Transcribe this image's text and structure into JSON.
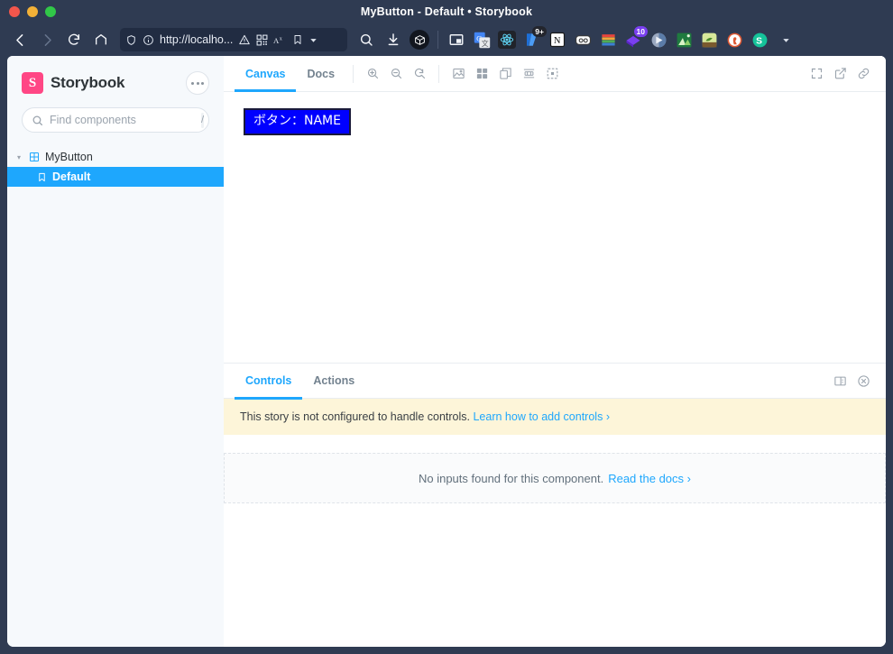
{
  "window": {
    "title": "MyButton - Default • Storybook"
  },
  "browser": {
    "back_icon": "back-arrow-icon",
    "forward_icon": "forward-arrow-icon",
    "reload_icon": "reload-icon",
    "home_icon": "home-icon",
    "url": "http://localho...",
    "url_icons": [
      "shield-icon",
      "info-icon",
      "warning-icon",
      "qr-code-icon",
      "reader-mode-icon",
      "bookmark-icon",
      "dropdown-chevron-icon"
    ],
    "search_icon": "search-icon",
    "downloads_icon": "downloads-icon",
    "storybook_ext_icon": "storybook-extension-icon",
    "extensions": [
      {
        "name": "picture-in-picture-icon",
        "badge": ""
      },
      {
        "name": "google-translate-icon",
        "badge": ""
      },
      {
        "name": "react-devtools-icon",
        "badge": ""
      },
      {
        "name": "vimium-icon",
        "badge": "9+"
      },
      {
        "name": "notion-icon",
        "badge": ""
      },
      {
        "name": "toby-icon",
        "badge": ""
      },
      {
        "name": "colorzilla-icon",
        "badge": ""
      },
      {
        "name": "purple-extension-icon",
        "badge": "10"
      },
      {
        "name": "video-speed-icon",
        "badge": ""
      },
      {
        "name": "green-extension-icon",
        "badge": ""
      },
      {
        "name": "olive-extension-icon",
        "badge": ""
      },
      {
        "name": "duckduckgo-icon",
        "badge": ""
      },
      {
        "name": "grammarly-icon",
        "badge": ""
      }
    ],
    "overflow_icon": "chevron-down-icon"
  },
  "sidebar": {
    "brand": "Storybook",
    "logo_letter": "S",
    "menu_icon": "ellipsis-icon",
    "search": {
      "placeholder": "Find components",
      "value": "",
      "shortcut": "/",
      "icon": "search-icon"
    },
    "tree": [
      {
        "label": "MyButton",
        "type": "component",
        "expanded": true,
        "icon": "component-grid-icon",
        "chevron": "▾"
      },
      {
        "label": "Default",
        "type": "story",
        "selected": true,
        "icon": "bookmark-icon"
      }
    ]
  },
  "canvas": {
    "tabs": [
      {
        "label": "Canvas",
        "active": true
      },
      {
        "label": "Docs",
        "active": false
      }
    ],
    "zoom_tools": [
      "zoom-in-icon",
      "zoom-out-icon",
      "zoom-reset-icon"
    ],
    "addon_tools": [
      "backgrounds-icon",
      "grid-icon",
      "viewport-icon",
      "measure-icon",
      "outline-icon"
    ],
    "right_tools": [
      "fullscreen-icon",
      "open-in-new-tab-icon",
      "copy-link-icon"
    ],
    "story": {
      "button_label": "ボタン：NAME",
      "button_bg": "#0000ff",
      "button_text_color": "#ffffff",
      "button_border": "#1a1a3a"
    }
  },
  "addon_panel": {
    "tabs": [
      {
        "label": "Controls",
        "active": true
      },
      {
        "label": "Actions",
        "active": false
      }
    ],
    "right_tools": [
      "panel-position-icon",
      "close-panel-icon"
    ],
    "notice": {
      "text": "This story is not configured to handle controls.",
      "link": "Learn how to add controls",
      "link_chevron": "›",
      "bg": "#fdf5d9"
    },
    "empty": {
      "text": "No inputs found for this component.",
      "link": "Read the docs",
      "link_chevron": "›"
    }
  },
  "colors": {
    "accent": "#1ea7fd",
    "brand": "#ff4785",
    "chrome": "#2f3b52"
  }
}
